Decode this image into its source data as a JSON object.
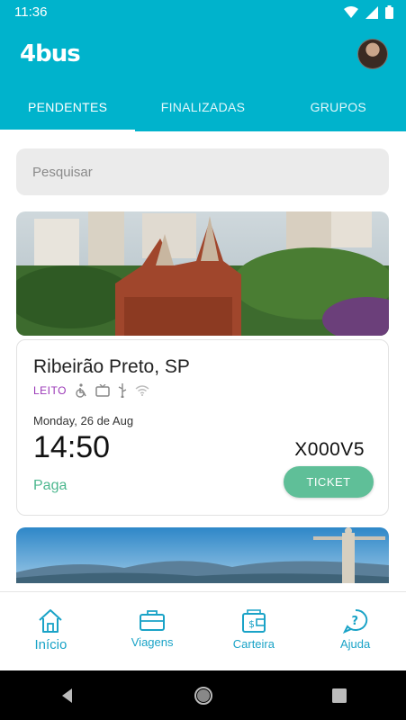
{
  "status_bar": {
    "time": "11:36"
  },
  "app": {
    "logo": "4bus"
  },
  "tabs": [
    {
      "label": "PENDENTES",
      "active": true
    },
    {
      "label": "FINALIZADAS",
      "active": false
    },
    {
      "label": "GRUPOS",
      "active": false
    }
  ],
  "search": {
    "placeholder": "Pesquisar",
    "value": ""
  },
  "trip": {
    "city": "Ribeirão Preto, SP",
    "seat_class": "LEITO",
    "amenities": [
      "wheelchair-icon",
      "tv-icon",
      "usb-icon",
      "wifi-icon"
    ],
    "date": "Monday, 26 de Aug",
    "time": "14:50",
    "code": "X000V5",
    "payment_status": "Paga",
    "ticket_label": "TICKET"
  },
  "bottom_nav": [
    {
      "label": "Início",
      "icon": "home-icon",
      "active": true
    },
    {
      "label": "Viagens",
      "icon": "briefcase-icon",
      "active": false
    },
    {
      "label": "Carteira",
      "icon": "wallet-icon",
      "active": false
    },
    {
      "label": "Ajuda",
      "icon": "help-icon",
      "active": false
    }
  ],
  "colors": {
    "primary": "#00b3cc",
    "accent_green": "#5fbf98",
    "seat_class_purple": "#9a37b7",
    "nav_icon": "#1aa3c7"
  }
}
